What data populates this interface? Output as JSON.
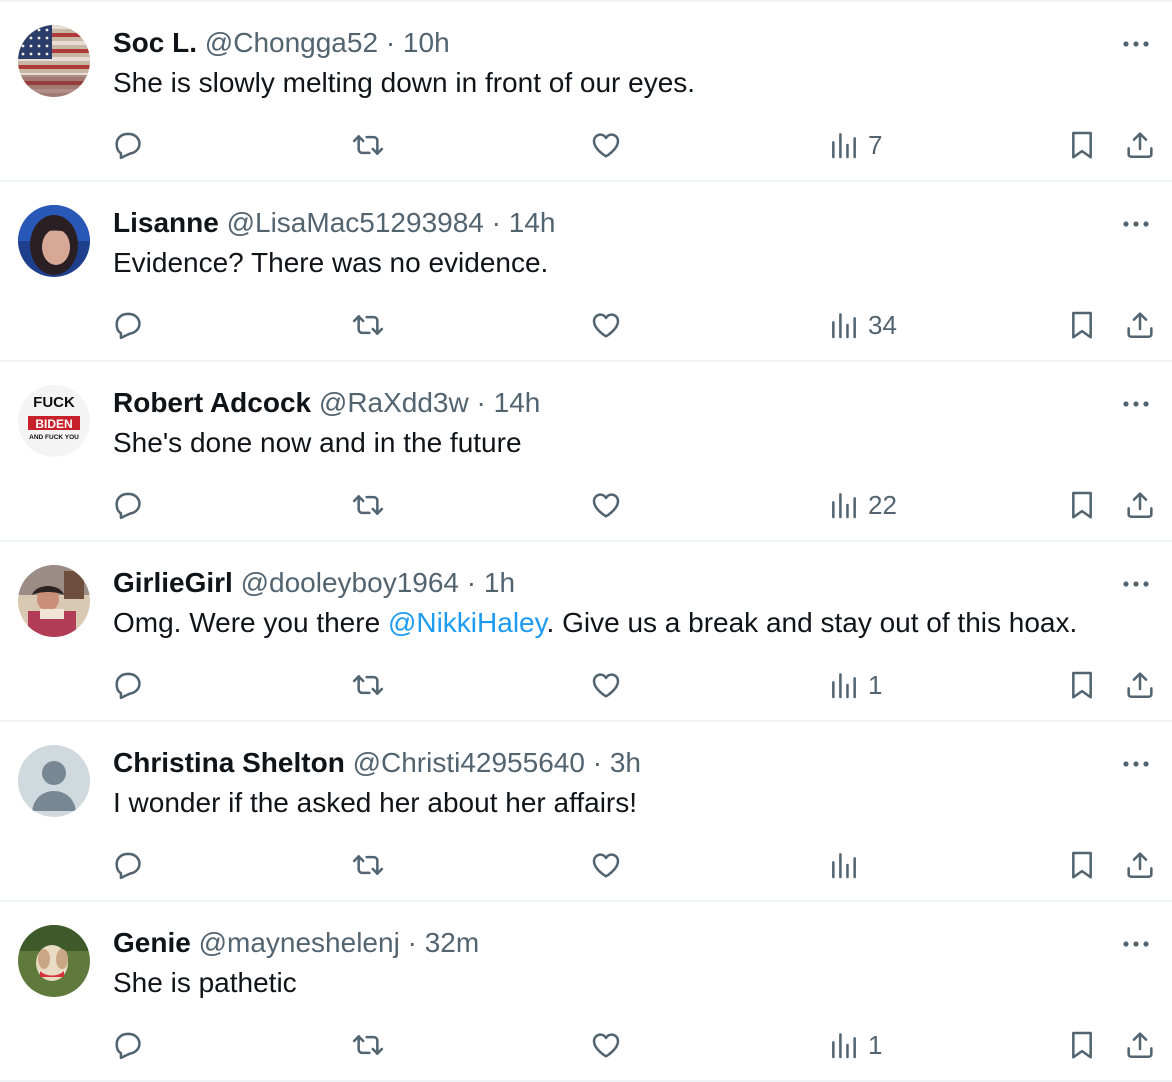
{
  "tweets": [
    {
      "name": "Soc L.",
      "handle": "@Chongga52",
      "separator": "·",
      "time": "10h",
      "body_parts": [
        {
          "text": "She is slowly melting down in front of our eyes."
        }
      ],
      "views": "7",
      "avatar": "flag-avatar"
    },
    {
      "name": "Lisanne",
      "handle": "@LisaMac51293984",
      "separator": "·",
      "time": "14h",
      "body_parts": [
        {
          "text": "Evidence? There was no evidence."
        }
      ],
      "views": "34",
      "avatar": "portrait-avatar"
    },
    {
      "name": "Robert Adcock",
      "handle": "@RaXdd3w",
      "separator": "·",
      "time": "14h",
      "body_parts": [
        {
          "text": "She's done now and in the future"
        }
      ],
      "views": "22",
      "avatar": "sticker-avatar"
    },
    {
      "name": "GirlieGirl",
      "handle": "@dooleyboy1964",
      "separator": "·",
      "time": "1h",
      "body_parts": [
        {
          "text": "Omg. Were you there "
        },
        {
          "text": "@NikkiHaley",
          "mention": true
        },
        {
          "text": ". Give us a break and stay out of this hoax."
        }
      ],
      "views": "1",
      "avatar": "photo-avatar"
    },
    {
      "name": "Christina Shelton",
      "handle": "@Christi42955640",
      "separator": "·",
      "time": "3h",
      "body_parts": [
        {
          "text": "I wonder if the asked her about her affairs!"
        }
      ],
      "views": "",
      "avatar": "default-avatar"
    },
    {
      "name": "Genie",
      "handle": "@mayneshelenj",
      "separator": "·",
      "time": "32m",
      "body_parts": [
        {
          "text": "She is pathetic"
        }
      ],
      "views": "1",
      "avatar": "dog-avatar"
    }
  ],
  "avatar_sticker_text": {
    "top": "FUCK",
    "middle": "BIDEN",
    "bottom": "AND FUCK YOU"
  },
  "colors": {
    "text_primary": "#0f1419",
    "text_secondary": "#536471",
    "mention": "#1d9bf0",
    "divider": "#eff3f4"
  },
  "icons": {
    "reply": "reply-icon",
    "retweet": "retweet-icon",
    "like": "heart-icon",
    "views": "views-icon",
    "bookmark": "bookmark-icon",
    "share": "share-icon",
    "more": "more-icon"
  }
}
